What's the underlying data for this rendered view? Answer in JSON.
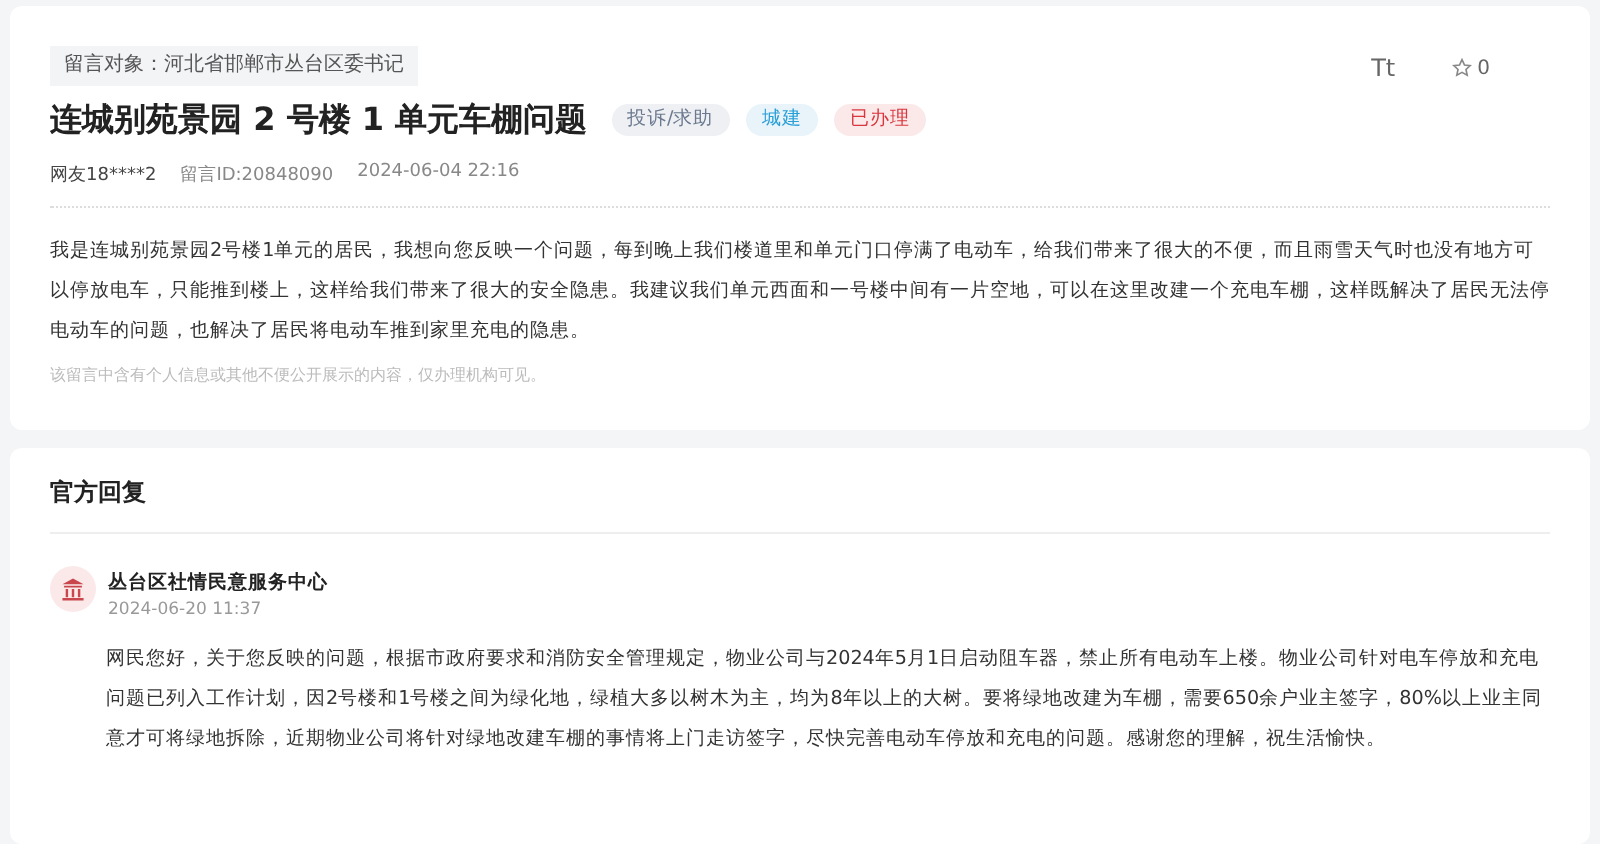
{
  "message": {
    "target": "留言对象：河北省邯郸市丛台区委书记",
    "title": "连城别苑景园 2 号楼 1 单元车棚问题",
    "tags": [
      {
        "label": "投诉/求助",
        "color": "#6b7a90"
      },
      {
        "label": "城建",
        "color": "#2a9fd6"
      },
      {
        "label": "已办理",
        "color": "#d9363e"
      }
    ],
    "font_button": "Tt",
    "likes": "0",
    "author": "网友18****2",
    "id": "留言ID:20848090",
    "time": "2024-06-04 22:16",
    "body": "我是连城别苑景园2号楼1单元的居民，我想向您反映一个问题，每到晚上我们楼道里和单元门口停满了电动车，给我们带来了很大的不便，而且雨雪天气时也没有地方可以停放电车，只能推到楼上，这样给我们带来了很大的安全隐患。我建议我们单元西面和一号楼中间有一片空地，可以在这里改建一个充电车棚，这样既解决了居民无法停电动车的问题，也解决了居民将电动车推到家里充电的隐患。",
    "privacy_note": "该留言中含有个人信息或其他不便公开展示的内容，仅办理机构可见。"
  },
  "reply": {
    "heading": "官方回复",
    "org": "丛台区社情民意服务中心",
    "time": "2024-06-20 11:37",
    "body": "网民您好，关于您反映的问题，根据市政府要求和消防安全管理规定，物业公司与2024年5月1日启动阻车器，禁止所有电动车上楼。物业公司针对电车停放和充电问题已列入工作计划，因2号楼和1号楼之间为绿化地，绿植大多以树木为主，均为8年以上的大树。要将绿地改建为车棚，需要650余户业主签字，80%以上业主同意才可将绿地拆除，近期物业公司将针对绿地改建车棚的事情将上门走访签字，尽快完善电动车停放和充电的问题。感谢您的理解，祝生活愉快。"
  }
}
